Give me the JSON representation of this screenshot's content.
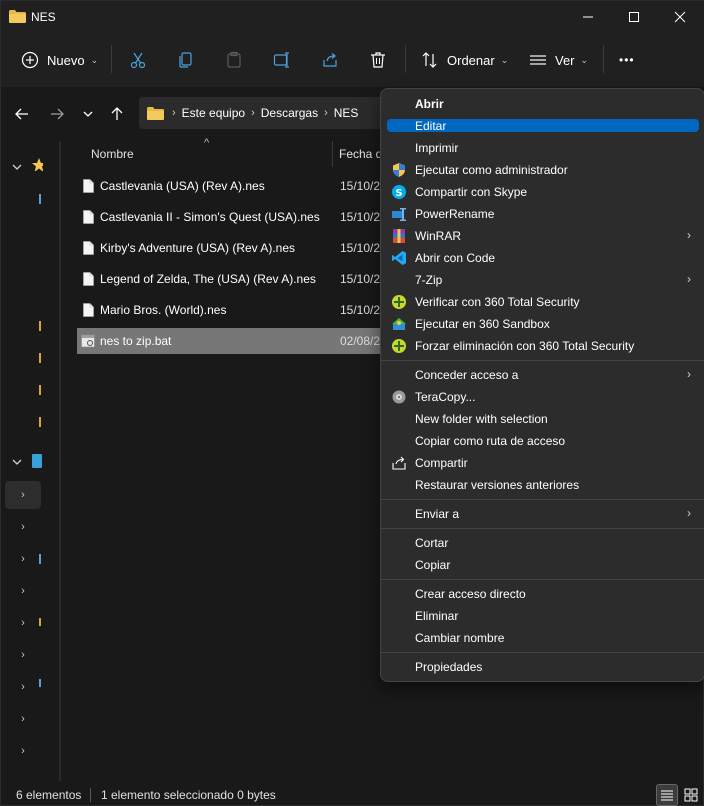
{
  "window": {
    "title": "NES"
  },
  "command_bar": {
    "new_label": "Nuevo",
    "sort_label": "Ordenar",
    "view_label": "Ver",
    "more_label": "•••"
  },
  "address": {
    "crumbs": [
      "Este equipo",
      "Descargas",
      "NES"
    ]
  },
  "columns": {
    "name": "Nombre",
    "date": "Fecha d"
  },
  "files": [
    {
      "name": "Castlevania (USA) (Rev A).nes",
      "date": "15/10/2"
    },
    {
      "name": "Castlevania II - Simon's Quest (USA).nes",
      "date": "15/10/2"
    },
    {
      "name": "Kirby's Adventure (USA) (Rev A).nes",
      "date": "15/10/2"
    },
    {
      "name": "Legend of Zelda, The (USA) (Rev A).nes",
      "date": "15/10/2"
    },
    {
      "name": "Mario Bros. (World).nes",
      "date": "15/10/2"
    },
    {
      "name": "nes to zip.bat",
      "date": "02/08/2"
    }
  ],
  "status": {
    "count": "6 elementos",
    "selection": "1 elemento seleccionado  0 bytes"
  },
  "context_menu": {
    "items": [
      {
        "label": "Abrir",
        "icon": ""
      },
      {
        "label": "Editar",
        "icon": ""
      },
      {
        "label": "Imprimir",
        "icon": ""
      },
      {
        "label": "Ejecutar como administrador",
        "icon": "shield-icon"
      },
      {
        "label": "Compartir con Skype",
        "icon": "skype-icon"
      },
      {
        "label": "PowerRename",
        "icon": "powerrename-icon"
      },
      {
        "label": "WinRAR",
        "icon": "winrar-icon"
      },
      {
        "label": "Abrir con Code",
        "icon": "vscode-icon"
      },
      {
        "label": "7-Zip",
        "icon": ""
      },
      {
        "label": "Verificar con 360 Total Security",
        "icon": "360-icon"
      },
      {
        "label": "Ejecutar en 360 Sandbox",
        "icon": "360-sandbox-icon"
      },
      {
        "label": "Forzar eliminación con 360 Total Security",
        "icon": "360-icon"
      },
      {
        "label": "Conceder acceso a",
        "icon": ""
      },
      {
        "label": "TeraCopy...",
        "icon": "teracopy-icon"
      },
      {
        "label": "New folder with selection",
        "icon": ""
      },
      {
        "label": "Copiar como ruta de acceso",
        "icon": ""
      },
      {
        "label": "Compartir",
        "icon": "share-icon"
      },
      {
        "label": "Restaurar versiones anteriores",
        "icon": ""
      },
      {
        "label": "Enviar a",
        "icon": ""
      },
      {
        "label": "Cortar",
        "icon": ""
      },
      {
        "label": "Copiar",
        "icon": ""
      },
      {
        "label": "Crear acceso directo",
        "icon": ""
      },
      {
        "label": "Eliminar",
        "icon": ""
      },
      {
        "label": "Cambiar nombre",
        "icon": ""
      },
      {
        "label": "Propiedades",
        "icon": ""
      }
    ]
  },
  "colors": {
    "highlight": "#0067c0",
    "selected_row": "#777777",
    "folder": "#e8b84a"
  }
}
